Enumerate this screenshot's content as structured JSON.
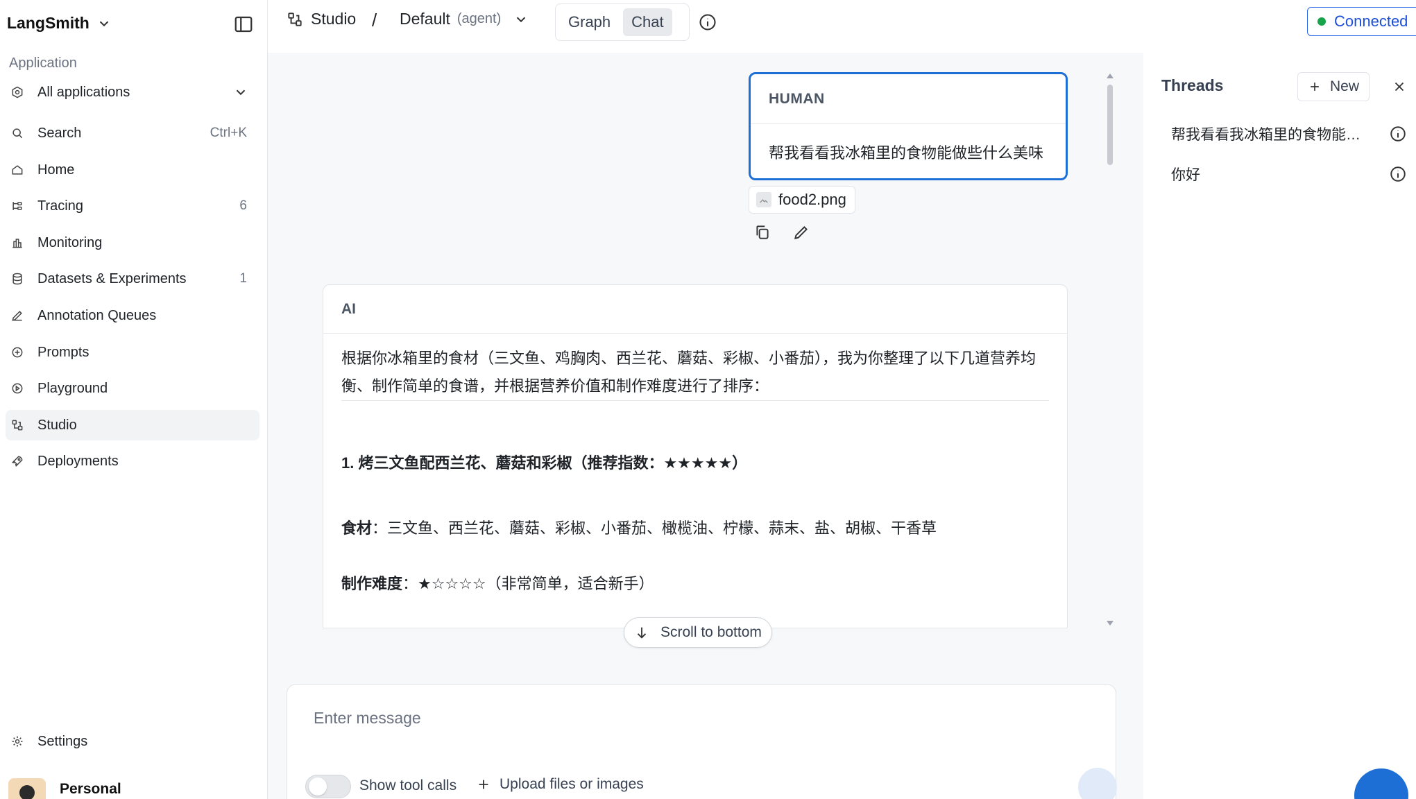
{
  "sidebar": {
    "brand": "LangSmith",
    "section_label": "Application",
    "apps_label": "All applications",
    "items": [
      {
        "label": "Search",
        "meta": "Ctrl+K"
      },
      {
        "label": "Home",
        "meta": ""
      },
      {
        "label": "Tracing",
        "meta": "6"
      },
      {
        "label": "Monitoring",
        "meta": ""
      },
      {
        "label": "Datasets & Experiments",
        "meta": "1"
      },
      {
        "label": "Annotation Queues",
        "meta": ""
      },
      {
        "label": "Prompts",
        "meta": ""
      },
      {
        "label": "Playground",
        "meta": ""
      },
      {
        "label": "Studio",
        "meta": ""
      },
      {
        "label": "Deployments",
        "meta": ""
      }
    ],
    "settings_label": "Settings",
    "profile_name": "Personal"
  },
  "topbar": {
    "studio_label": "Studio",
    "separator": "/",
    "graph_name": "Default",
    "graph_sub": "(agent)",
    "tab_graph": "Graph",
    "tab_chat": "Chat",
    "status": "Connected"
  },
  "chat": {
    "human_role": "HUMAN",
    "human_text": "帮我看看我冰箱里的食物能做些什么美味",
    "attachment": "food2.png",
    "ai_role": "AI",
    "ai_intro": "根据你冰箱里的食材（三文鱼、鸡胸肉、西兰花、蘑菇、彩椒、小番茄），我为你整理了以下几道营养均衡、制作简单的食谱，并根据营养价值和制作难度进行了排序：",
    "ai_heading": "1. 烤三文鱼配西兰花、蘑菇和彩椒（推荐指数：★★★★★）",
    "ingredients_label": "食材",
    "ingredients_value": "：三文鱼、西兰花、蘑菇、彩椒、小番茄、橄榄油、柠檬、蒜末、盐、胡椒、干香草",
    "difficulty_label": "制作难度",
    "difficulty_value": "：★☆☆☆☆（非常简单，适合新手）",
    "scroll_bottom": "Scroll to bottom",
    "input_placeholder": "Enter message",
    "show_tool_calls": "Show tool calls",
    "upload_label": "Upload files or images"
  },
  "threads": {
    "title": "Threads",
    "new_label": "New",
    "items": [
      {
        "title": "帮我看看我冰箱里的食物能做..."
      },
      {
        "title": "你好"
      }
    ]
  },
  "colors": {
    "accent": "#1d6fd6",
    "connected_dot": "#16a34a",
    "active_nav": "#f2f3f5"
  }
}
